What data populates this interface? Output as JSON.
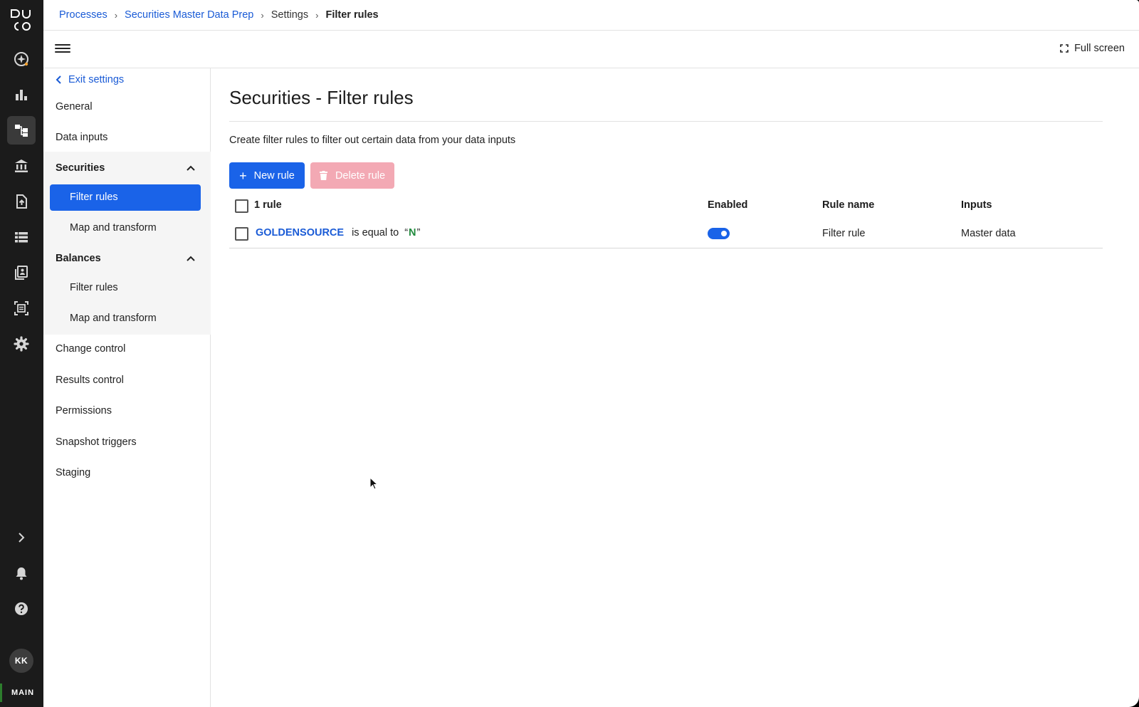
{
  "rail": {
    "logo_letters": "DUCO",
    "user_initials": "KK",
    "environment": "MAIN"
  },
  "breadcrumb": {
    "items": [
      "Processes",
      "Securities Master Data Prep",
      "Settings"
    ],
    "current": "Filter rules"
  },
  "toolbar": {
    "fullscreen_label": "Full screen"
  },
  "sidebar": {
    "exit_label": "Exit settings",
    "general": "General",
    "data_inputs": "Data inputs",
    "securities": {
      "label": "Securities",
      "items": [
        "Filter rules",
        "Map and transform"
      ]
    },
    "balances": {
      "label": "Balances",
      "items": [
        "Filter rules",
        "Map and transform"
      ]
    },
    "change_control": "Change control",
    "results_control": "Results control",
    "permissions": "Permissions",
    "snapshot_triggers": "Snapshot triggers",
    "staging": "Staging"
  },
  "main": {
    "title": "Securities - Filter rules",
    "description": "Create filter rules to filter out certain data from your data inputs",
    "new_rule_label": "New rule",
    "delete_rule_label": "Delete rule",
    "table": {
      "count_label": "1 rule",
      "headers": {
        "enabled": "Enabled",
        "rule_name": "Rule name",
        "inputs": "Inputs"
      },
      "rows": [
        {
          "field": "GOLDENSOURCE",
          "operator": "is equal to",
          "open_quote": "“",
          "value": "N",
          "close_quote": "”",
          "enabled": true,
          "rule_name": "Filter rule",
          "inputs": "Master data"
        }
      ]
    }
  },
  "colors": {
    "accent": "#1a63e8",
    "link": "#1a5bd6",
    "rail_bg": "#1b1b1b",
    "disabled_danger": "#f3a9b4",
    "value_green": "#1f8a3c"
  }
}
